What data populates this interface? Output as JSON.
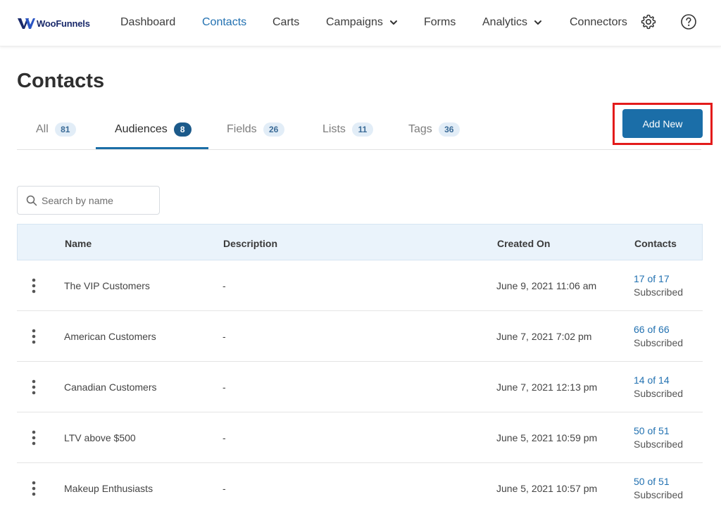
{
  "brand": {
    "name": "WooFunnels"
  },
  "nav": {
    "dashboard": "Dashboard",
    "contacts": "Contacts",
    "carts": "Carts",
    "campaigns": "Campaigns",
    "forms": "Forms",
    "analytics": "Analytics",
    "connectors": "Connectors"
  },
  "page": {
    "title": "Contacts"
  },
  "tabs": [
    {
      "label": "All",
      "count": "81"
    },
    {
      "label": "Audiences",
      "count": "8"
    },
    {
      "label": "Fields",
      "count": "26"
    },
    {
      "label": "Lists",
      "count": "11"
    },
    {
      "label": "Tags",
      "count": "36"
    }
  ],
  "actions": {
    "add_new": "Add New"
  },
  "search": {
    "placeholder": "Search by name",
    "value": ""
  },
  "table": {
    "columns": {
      "name": "Name",
      "description": "Description",
      "created": "Created On",
      "contacts": "Contacts"
    },
    "rows": [
      {
        "name": "The VIP Customers",
        "description": "-",
        "created": "June 9, 2021 11:06 am",
        "count": "17 of 17",
        "status": "Subscribed"
      },
      {
        "name": "American Customers",
        "description": "-",
        "created": "June 7, 2021 7:02 pm",
        "count": "66 of 66",
        "status": "Subscribed"
      },
      {
        "name": "Canadian Customers",
        "description": "-",
        "created": "June 7, 2021 12:13 pm",
        "count": "14 of 14",
        "status": "Subscribed"
      },
      {
        "name": "LTV above $500",
        "description": "-",
        "created": "June 5, 2021 10:59 pm",
        "count": "50 of 51",
        "status": "Subscribed"
      },
      {
        "name": "Makeup Enthusiasts",
        "description": "-",
        "created": "June 5, 2021 10:57 pm",
        "count": "50 of 51",
        "status": "Subscribed"
      }
    ]
  },
  "colors": {
    "accent": "#1b6ea8",
    "link": "#2271b1",
    "highlight": "#e31b1b",
    "header_bg": "#eaf3fb"
  },
  "icons": [
    "logo-icon",
    "chevron-down-icon",
    "gear-icon",
    "help-icon",
    "search-icon",
    "kebab-menu-icon"
  ]
}
